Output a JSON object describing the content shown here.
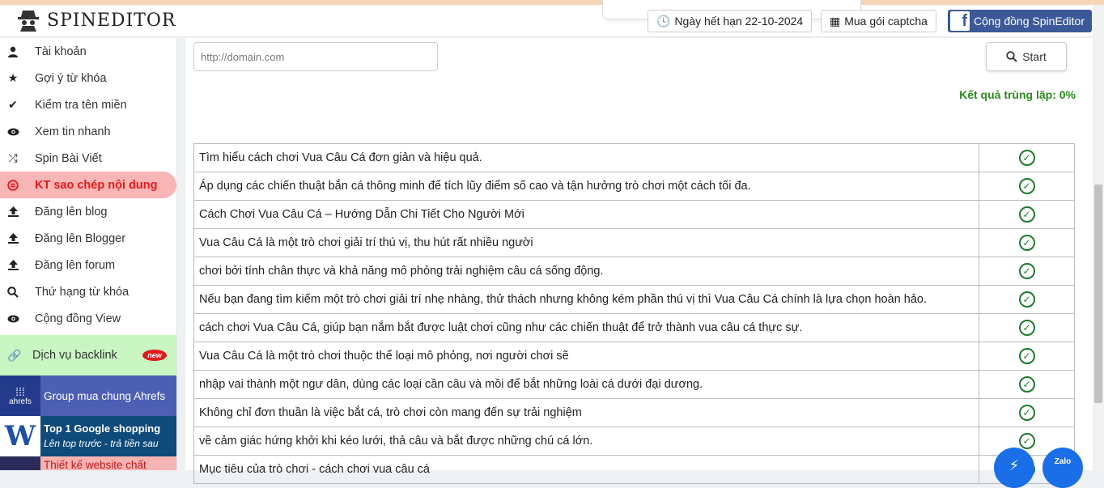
{
  "brand": {
    "name": "SPINEDITOR"
  },
  "header": {
    "expiry_label": "Ngày hết hạn 22-10-2024",
    "captcha_label": "Mua gói captcha",
    "community_label": "Cộng đồng SpinEditor"
  },
  "sidebar": {
    "items": [
      {
        "label": "Tài khoản",
        "icon": "user-icon"
      },
      {
        "label": "Gợi ý từ khóa",
        "icon": "star-icon"
      },
      {
        "label": "Kiểm tra tên miền",
        "icon": "check-icon"
      },
      {
        "label": "Xem tin nhanh",
        "icon": "eye-icon"
      },
      {
        "label": "Spin Bài Viết",
        "icon": "shuffle-icon"
      },
      {
        "label": "KT sao chép nội dung",
        "icon": "copyright-icon",
        "active": true
      },
      {
        "label": "Đăng lên blog",
        "icon": "upload-icon"
      },
      {
        "label": "Đăng lên Blogger",
        "icon": "upload-icon"
      },
      {
        "label": "Đăng lên forum",
        "icon": "upload-icon"
      },
      {
        "label": "Thứ hạng từ khóa",
        "icon": "search-icon"
      },
      {
        "label": "Cộng đồng View",
        "icon": "eye-icon"
      }
    ],
    "backlink": {
      "label": "Dịch vụ backlink",
      "badge": "new"
    },
    "promos": {
      "ahrefs": {
        "logo_text": "ahrefs",
        "label": "Group mua chung Ahrefs"
      },
      "google": {
        "title": "Top 1 Google shopping",
        "subtitle": "Lên top trước - trả tiền sau"
      },
      "web": {
        "label": "Thiết kế website chất"
      }
    }
  },
  "main": {
    "url_placeholder": "http://domain.com",
    "start_label": "Start",
    "result_label": "Kết quả trùng lặp: 0%",
    "rows": [
      "Tìm hiểu cách chơi Vua Câu Cá đơn giản và hiệu quả.",
      "Áp dụng các chiến thuật bắn cá thông minh để tích lũy điểm số cao và tận hưởng trò chơi một cách tối đa.",
      "Cách Chơi Vua Câu Cá – Hướng Dẫn Chi Tiết Cho Người Mới",
      "Vua Câu Cá là một trò chơi giải trí thú vị, thu hút rất nhiều người",
      "chơi bởi tính chân thực và khả năng mô phỏng trải nghiệm câu cá sống động.",
      "Nếu bạn đang tìm kiếm một trò chơi giải trí nhẹ nhàng, thử thách nhưng không kém phần thú vị thì Vua Câu Cá chính là lựa chọn hoàn hảo.",
      "cách chơi Vua Câu Cá, giúp bạn nắm bắt được luật chơi cũng như các chiến thuật để trở thành vua câu cá thực sự.",
      "Vua Câu Cá là một trò chơi thuộc thể loại mô phỏng, nơi người chơi sẽ",
      "nhập vai thành một ngư dân, dùng các loại cần câu và mồi để bắt những loài cá dưới đại dương.",
      "Không chỉ đơn thuần là việc bắt cá, trò chơi còn mang đến sự trải nghiệm",
      "về cảm giác hứng khởi khi kéo lưới, thả câu và bắt được những chú cá lớn.",
      "Mục tiêu của trò chơi - cách chơi vua câu cá"
    ]
  },
  "floating": {
    "zalo_label": "Zalo"
  },
  "colors": {
    "accent_red": "#e01b1b",
    "active_bg": "#f8b5b5",
    "success": "#1f7a2e",
    "facebook": "#3b5998"
  }
}
